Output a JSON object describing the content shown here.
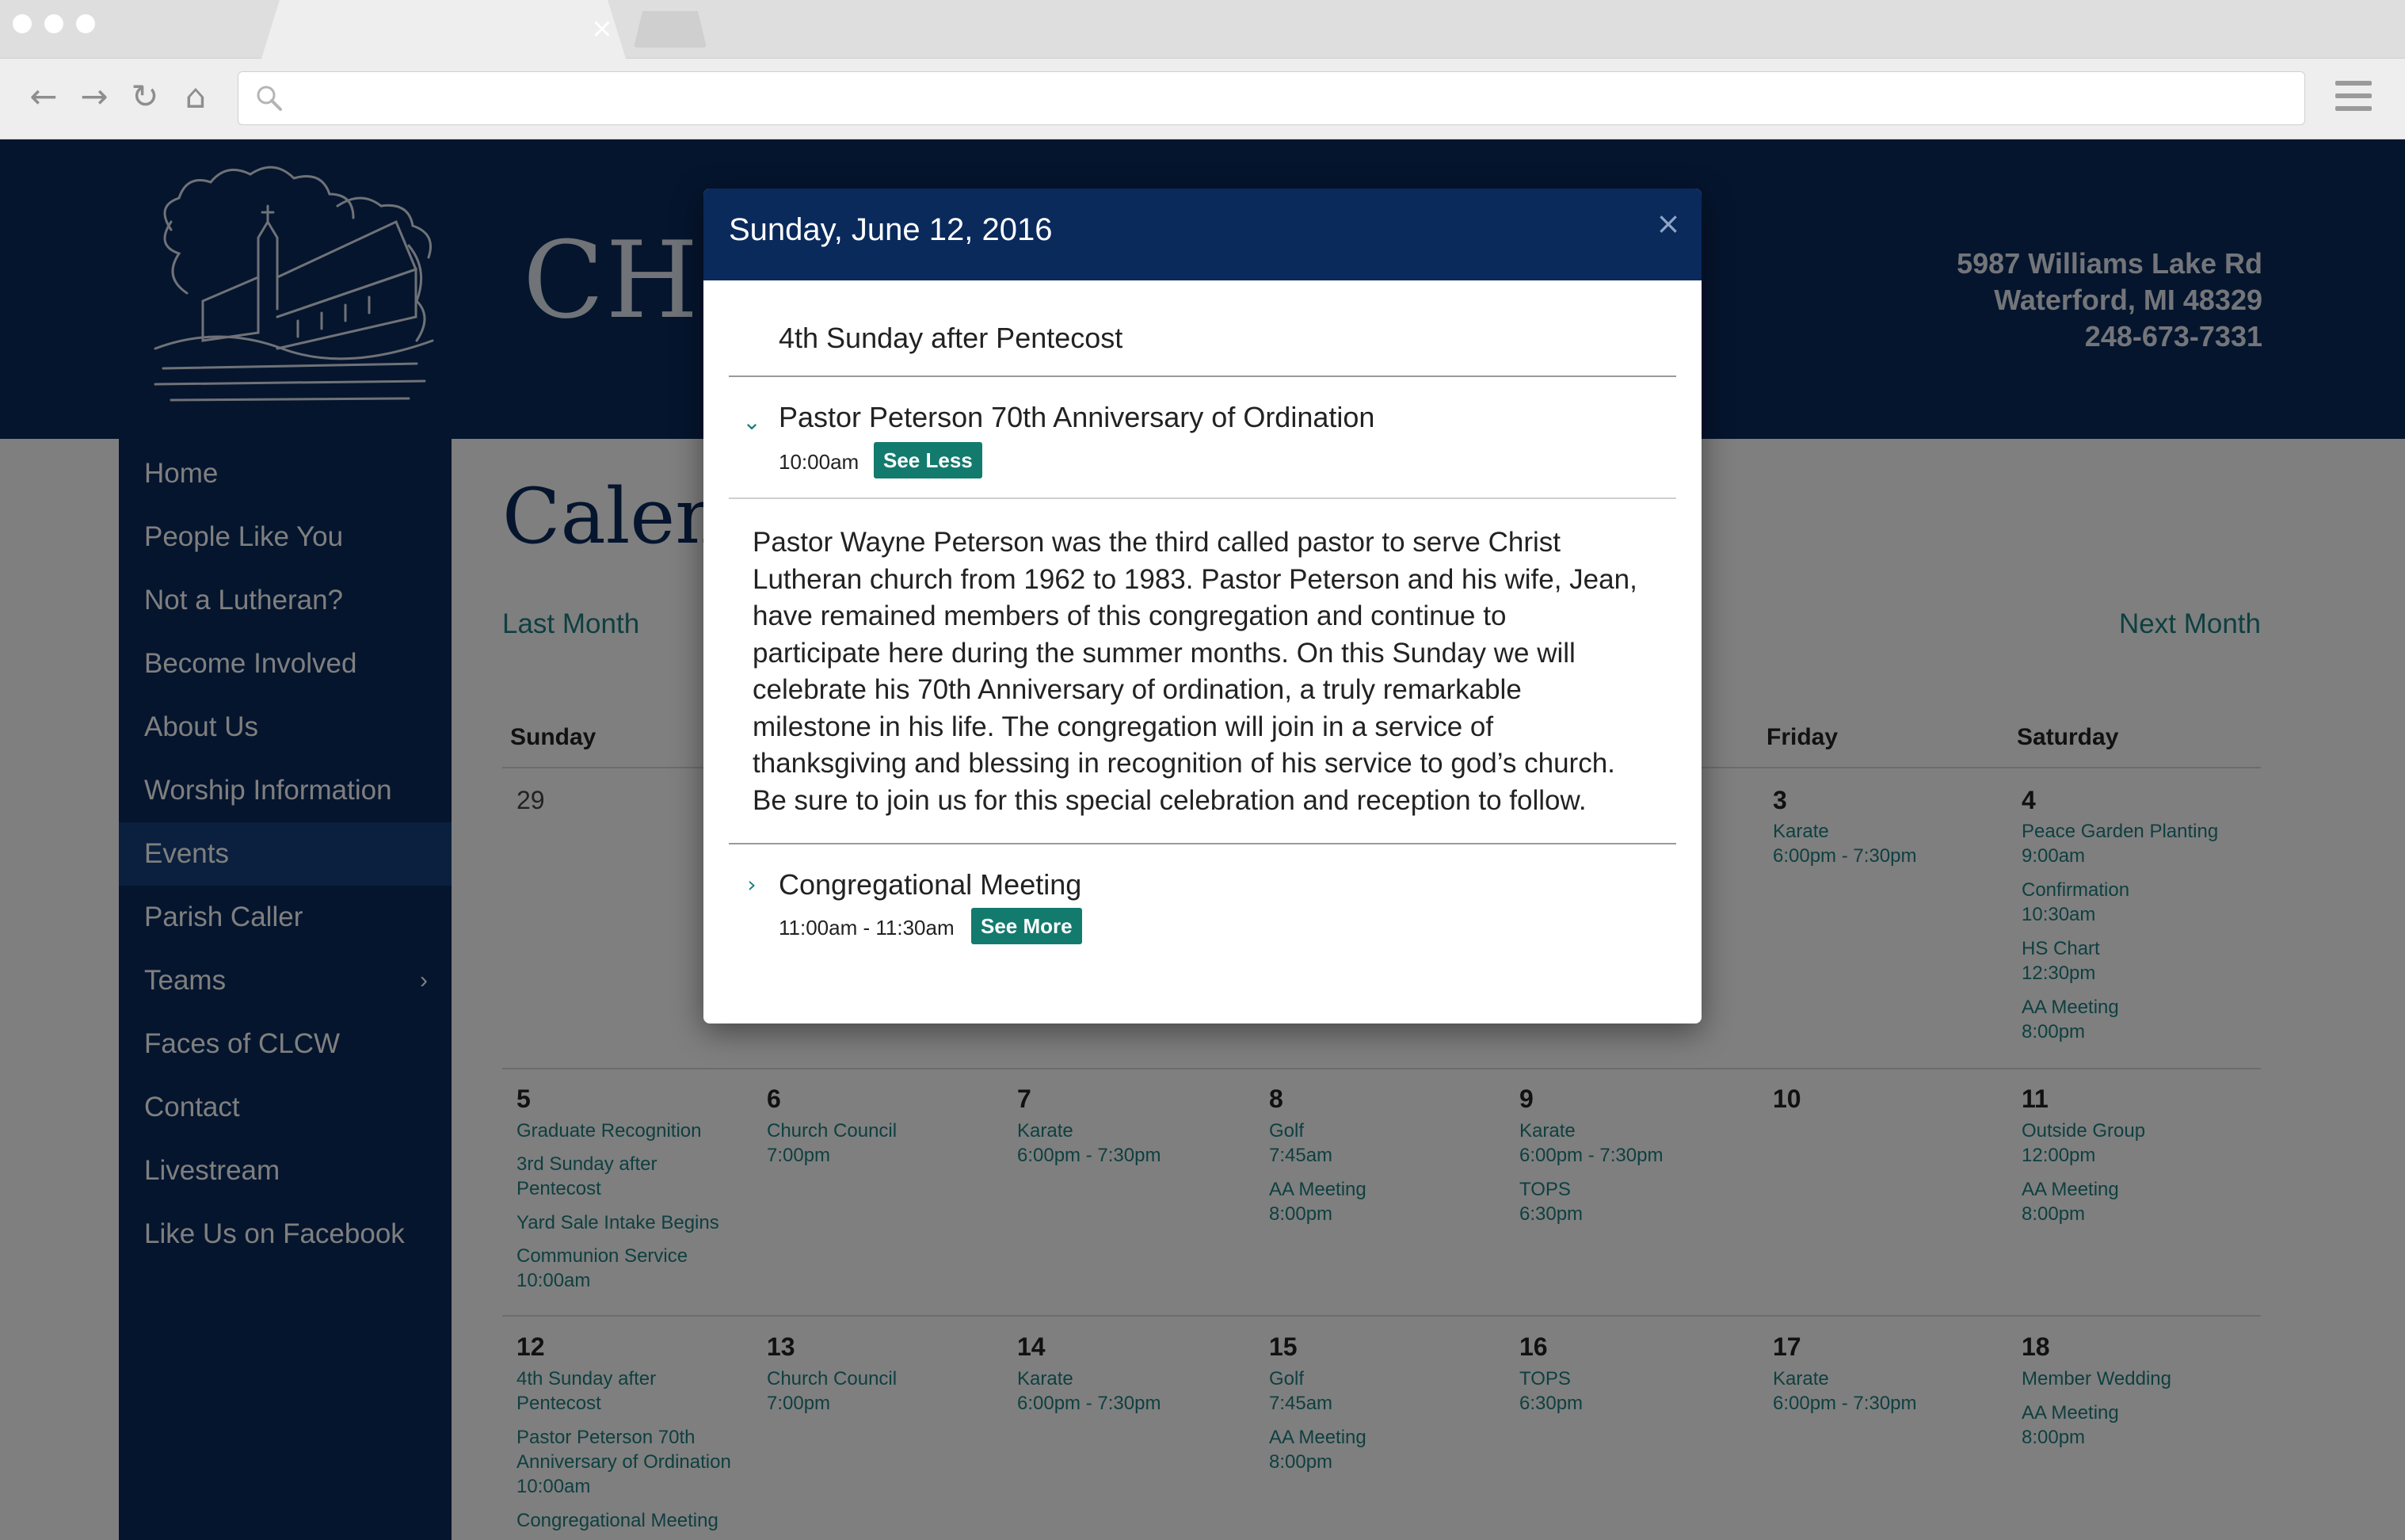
{
  "browser": {
    "tab_close_glyph": "×",
    "nav": {
      "back": "←",
      "forward": "→",
      "reload": "↻",
      "home": "⌂"
    },
    "address_value": ""
  },
  "site": {
    "title_visible": "CHR",
    "address_line1": "5987 Williams Lake Rd",
    "address_line2": "Waterford, MI 48329",
    "phone": "248-673-7331"
  },
  "sidebar": {
    "items": [
      {
        "label": "Home"
      },
      {
        "label": "People Like You"
      },
      {
        "label": "Not a Lutheran?"
      },
      {
        "label": "Become Involved"
      },
      {
        "label": "About Us"
      },
      {
        "label": "Worship Information"
      },
      {
        "label": "Events",
        "active": true
      },
      {
        "label": "Parish Caller"
      },
      {
        "label": "Teams",
        "has_submenu": true
      },
      {
        "label": "Faces of CLCW"
      },
      {
        "label": "Contact"
      },
      {
        "label": "Livestream"
      },
      {
        "label": "Like Us on Facebook"
      }
    ],
    "submenu_glyph": "›"
  },
  "main": {
    "heading_visible": "Calend",
    "last_month": "Last Month",
    "next_month": "Next Month"
  },
  "calendar": {
    "weekday_headers": [
      "Sunday",
      "Friday",
      "Saturday"
    ],
    "week1": {
      "sun": "29",
      "fri": {
        "num": "3",
        "events": [
          "Karate",
          "6:00pm - 7:30pm"
        ]
      },
      "sat": {
        "num": "4",
        "events": [
          "Peace Garden Planting",
          "9:00am",
          "Confirmation",
          "10:30am",
          "HS Chart",
          "12:30pm",
          "AA Meeting",
          "8:00pm"
        ]
      }
    },
    "week2": {
      "sun": {
        "num": "5",
        "events": [
          "Graduate Recognition",
          "3rd Sunday after",
          "Pentecost",
          "Yard Sale Intake Begins",
          "Communion Service",
          "10:00am"
        ]
      },
      "mon": {
        "num": "6",
        "events": [
          "Church Council",
          "7:00pm"
        ]
      },
      "tue": {
        "num": "7",
        "events": [
          "Karate",
          "6:00pm - 7:30pm"
        ]
      },
      "wed": {
        "num": "8",
        "events": [
          "Golf",
          "7:45am",
          "AA Meeting",
          "8:00pm"
        ]
      },
      "thu": {
        "num": "9",
        "events": [
          "Karate",
          "6:00pm - 7:30pm",
          "TOPS",
          "6:30pm"
        ]
      },
      "fri": {
        "num": "10",
        "events": []
      },
      "sat": {
        "num": "11",
        "events": [
          "Outside Group",
          "12:00pm",
          "AA Meeting",
          "8:00pm"
        ]
      }
    },
    "week3": {
      "sun": {
        "num": "12",
        "events": [
          "4th Sunday after",
          "Pentecost",
          "Pastor Peterson 70th",
          "Anniversary of Ordination",
          "10:00am",
          "Congregational Meeting"
        ]
      },
      "mon": {
        "num": "13",
        "events": [
          "Church Council",
          "7:00pm"
        ]
      },
      "tue": {
        "num": "14",
        "events": [
          "Karate",
          "6:00pm - 7:30pm"
        ]
      },
      "wed": {
        "num": "15",
        "events": [
          "Golf",
          "7:45am",
          "AA Meeting",
          "8:00pm"
        ]
      },
      "thu": {
        "num": "16",
        "events": [
          "TOPS",
          "6:30pm"
        ]
      },
      "fri": {
        "num": "17",
        "events": [
          "Karate",
          "6:00pm - 7:30pm"
        ]
      },
      "sat": {
        "num": "18",
        "events": [
          "Member Wedding",
          "AA Meeting",
          "8:00pm"
        ]
      }
    }
  },
  "modal": {
    "title": "Sunday, June 12, 2016",
    "close_glyph": "×",
    "subtitle": "4th Sunday after Pentecost",
    "event1": {
      "title": "Pastor Peterson 70th Anniversary of Ordination",
      "time": "10:00am",
      "toggle_label": "See Less",
      "expanded": true,
      "description_lines": [
        "Pastor Wayne Peterson was the third called pastor to serve Christ",
        "Lutheran church from 1962 to 1983. Pastor Peterson and his wife, Jean,",
        "have remained members of this congregation and continue to",
        "participate here during the summer months. On this Sunday we will",
        "celebrate his 70th Anniversary of ordination, a truly remarkable",
        "milestone in his life. The congregation will join in a service of",
        "thanksgiving and blessing in recognition of his service to god’s church.",
        "Be sure to join us for this special celebration and reception to follow."
      ]
    },
    "event2": {
      "title": "Congregational Meeting",
      "time": "11:00am - 11:30am",
      "toggle_label": "See More",
      "expanded": false
    }
  },
  "colors": {
    "navy": "#0a2a5c",
    "teal_link": "#1e7f80",
    "teal_button": "#137a6e",
    "chrome_gray": "#dedede"
  }
}
